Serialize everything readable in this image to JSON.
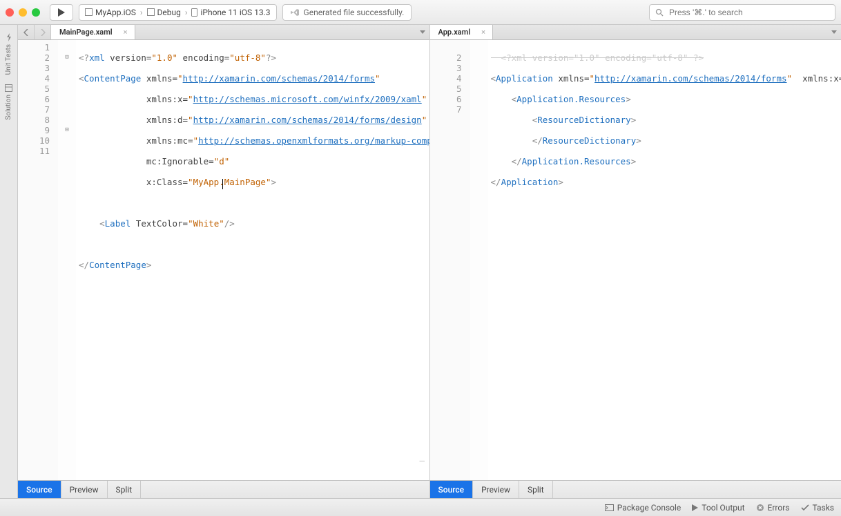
{
  "titlebar": {
    "breadcrumb": {
      "project": "MyApp.iOS",
      "config": "Debug",
      "device": "iPhone 11 iOS 13.3"
    },
    "status": "Generated file successfully.",
    "search_placeholder": "Press '⌘.' to search"
  },
  "sidebar": {
    "items": [
      {
        "label": "Unit Tests"
      },
      {
        "label": "Solution"
      }
    ]
  },
  "left_editor": {
    "tab": {
      "title": "MainPage.xaml"
    },
    "view_tabs": {
      "source": "Source",
      "preview": "Preview",
      "split": "Split"
    },
    "lines": [
      "1",
      "2",
      "3",
      "4",
      "5",
      "6",
      "7",
      "8",
      "9",
      "10",
      "11"
    ],
    "code": {
      "l1_a": "<?",
      "l1_b": "xml",
      "l1_c": " version=",
      "l1_d": "\"1.0\"",
      "l1_e": " encoding=",
      "l1_f": "\"utf-8\"",
      "l1_g": "?>",
      "l2_a": "<",
      "l2_b": "ContentPage",
      "l2_c": " xmlns=",
      "l2_d": "\"",
      "l2_u": "http://xamarin.com/schemas/2014/forms",
      "l2_e": "\"",
      "l3_a": "             xmlns:x=",
      "l3_d": "\"",
      "l3_u": "http://schemas.microsoft.com/winfx/2009/xaml",
      "l3_e": "\"",
      "l4_a": "             xmlns:d=",
      "l4_d": "\"",
      "l4_u": "http://xamarin.com/schemas/2014/forms/design",
      "l4_e": "\"",
      "l5_a": "             xmlns:mc=",
      "l5_d": "\"",
      "l5_u": "http://schemas.openxmlformats.org/markup-comp",
      "l6_a": "             mc:Ignorable=",
      "l6_d": "\"d\"",
      "l7_a": "             x:Class=",
      "l7_d": "\"",
      "l7_s": "MyApp.MainPage",
      "l7_e": "\"",
      "l7_g": ">",
      "l9_a": "    <",
      "l9_b": "Label",
      "l9_c": " TextColor=",
      "l9_d": "\"",
      "l9_s": "White",
      "l9_e": "\"",
      "l9_g": "/>",
      "l11_a": "</",
      "l11_b": "ContentPage",
      "l11_c": ">"
    }
  },
  "right_editor": {
    "tab": {
      "title": "App.xaml"
    },
    "view_tabs": {
      "source": "Source",
      "preview": "Preview",
      "split": "Split"
    },
    "lines": [
      "2",
      "3",
      "4",
      "5",
      "6",
      "7"
    ],
    "code": {
      "l1_trunc": "  <?xml version=\"1.0\" encoding=\"utf-8\" ?>",
      "l2_a": "<",
      "l2_b": "Application",
      "l2_c": " xmlns=",
      "l2_d": "\"",
      "l2_u": "http://xamarin.com/schemas/2014/forms",
      "l2_e": "\"",
      "l2_f": "  xmlns:x=",
      "l3_a": "    <",
      "l3_b": "Application.Resources",
      "l3_c": ">",
      "l4_a": "        <",
      "l4_b": "ResourceDictionary",
      "l4_c": ">",
      "l5_a": "        </",
      "l5_b": "ResourceDictionary",
      "l5_c": ">",
      "l6_a": "    </",
      "l6_b": "Application.Resources",
      "l6_c": ">",
      "l7_a": "</",
      "l7_b": "Application",
      "l7_c": ">"
    }
  },
  "statusbar": {
    "package_console": "Package Console",
    "tool_output": "Tool Output",
    "errors": "Errors",
    "tasks": "Tasks"
  }
}
